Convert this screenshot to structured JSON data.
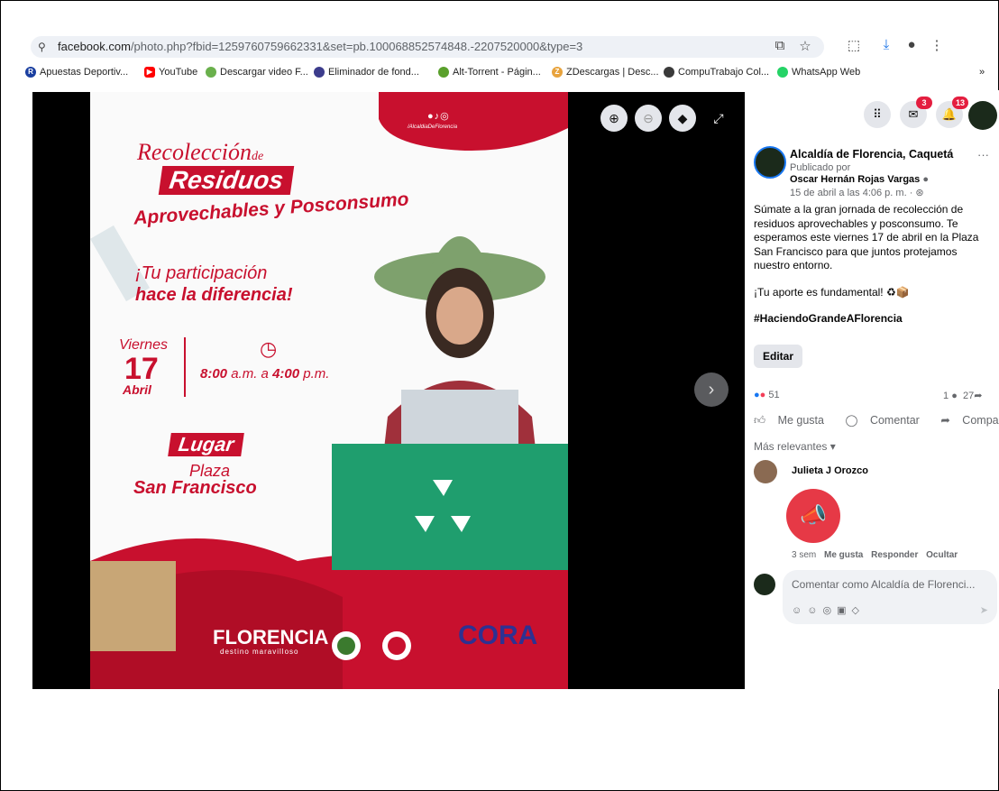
{
  "browser": {
    "url_domain": "facebook.com",
    "url_rest": "/photo.php?fbid=1259760759662331&set=pb.100068852574848.-2207520000&type=3",
    "bookmarks": [
      {
        "label": "Apuestas Deportiv...",
        "icon": "R",
        "color": "#1a3fa0"
      },
      {
        "label": "YouTube",
        "icon": "▶",
        "color": "#ff0000"
      },
      {
        "label": "Descargar video F...",
        "icon": "●",
        "color": "#6ab04c"
      },
      {
        "label": "Eliminador de fond...",
        "icon": "●",
        "color": "#3c3c8c"
      },
      {
        "label": "Alt-Torrent - Págin...",
        "icon": "●",
        "color": "#5aa02c"
      },
      {
        "label": "ZDescargas | Desc...",
        "icon": "Z",
        "color": "#e8a33d"
      },
      {
        "label": "CompuTrabajo Col...",
        "icon": "●",
        "color": "#3a3a3a"
      },
      {
        "label": "WhatsApp Web",
        "icon": "●",
        "color": "#25d366"
      }
    ],
    "bookmarks_more": "»"
  },
  "poster": {
    "title_line1": "Recolección",
    "title_de": "de",
    "title_residuos": "Residuos",
    "title_aprov": "Aprovechables y Posconsumo",
    "part_line1": "¡Tu participación",
    "part_line2": "hace la diferencia!",
    "day_name": "Viernes",
    "day_num": "17",
    "month": "Abril",
    "time_start": "8:00",
    "time_mid": " a.m. a ",
    "time_end": "4:00",
    "time_suffix": " p.m.",
    "lugar": "Lugar",
    "plaza": "Plaza",
    "place": "San Francisco",
    "handle": "/AlcaldiaDeFlorencia",
    "brand": "FLORENCIA",
    "brand_tag": "destino maravilloso",
    "cora": "CORA"
  },
  "post": {
    "page_name": "Alcaldía de Florencia, Caquetá",
    "published_by": "Publicado por",
    "author": "Oscar Hernán Rojas Vargas",
    "date": "15 de abril a las 4:06 p. m. ·",
    "body_p1": "Súmate a la gran jornada de recolección de residuos aprovechables y posconsumo. Te esperamos este viernes 17 de abril en la Plaza San Francisco para que juntos protejamos nuestro entorno.",
    "body_p2": "¡Tu aporte es fundamental! ♻📦",
    "hashtag": "#HaciendoGrandeAFlorencia",
    "edit_label": "Editar",
    "reactions_count": "51",
    "comments_count": "1",
    "shares_count": "27",
    "like_label": "Me gusta",
    "comment_label": "Comentar",
    "share_label": "Compartir",
    "sort_label": "Más relevantes ▾"
  },
  "comment": {
    "author": "Julieta J Orozco",
    "age": "3 sem",
    "like": "Me gusta",
    "reply": "Responder",
    "hide": "Ocultar"
  },
  "composer": {
    "placeholder": "Comentar como Alcaldía de Florenci..."
  },
  "notifications": {
    "messenger_badge": "3",
    "bell_badge": "13"
  }
}
